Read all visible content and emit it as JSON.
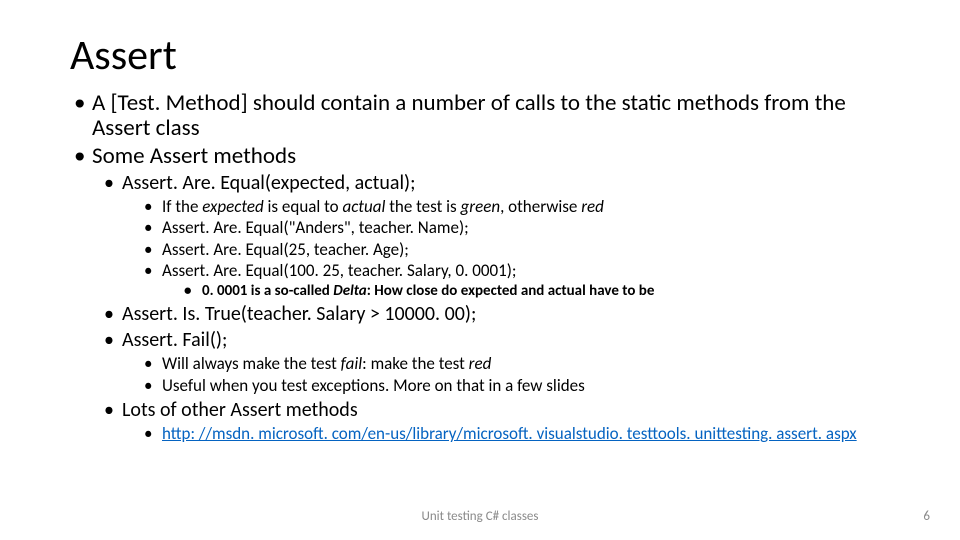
{
  "title": "Assert",
  "l1_a": "A [Test. Method] should contain a number of calls to the static methods from the Assert class",
  "l1_b": "Some Assert methods",
  "l2_a": "Assert. Are. Equal(expected, actual);",
  "l3": {
    "a_pre": "If the ",
    "a_exp": "expected",
    "a_mid": " is equal to ",
    "a_act": "actual",
    "a_mid2": " the test is ",
    "a_green": "green",
    "a_mid3": ", otherwise ",
    "a_red": "red",
    "b": "Assert. Are. Equal(\"Anders\", teacher. Name);",
    "c": "Assert. Are. Equal(25, teacher. Age);",
    "d": "Assert. Are. Equal(100. 25, teacher. Salary, 0. 0001);"
  },
  "l4_a_pre": "0. 0001 is a so-called ",
  "l4_a_delta": "Delta",
  "l4_a_post": ": How close do expected and actual have to be",
  "l2_b": "Assert. Is. True(teacher. Salary > 10000. 00);",
  "l2_c": "Assert. Fail();",
  "l3b": {
    "a_pre": "Will always make the test ",
    "a_fail": "fail",
    "a_post": ": make the test ",
    "a_red": "red",
    "b": "Useful when you test exceptions. More on that in a few slides"
  },
  "l2_d": "Lots of other Assert methods",
  "link": "http: //msdn. microsoft. com/en-us/library/microsoft. visualstudio. testtools. unittesting. assert. aspx",
  "footer_center": "Unit testing C# classes",
  "footer_right": "6"
}
